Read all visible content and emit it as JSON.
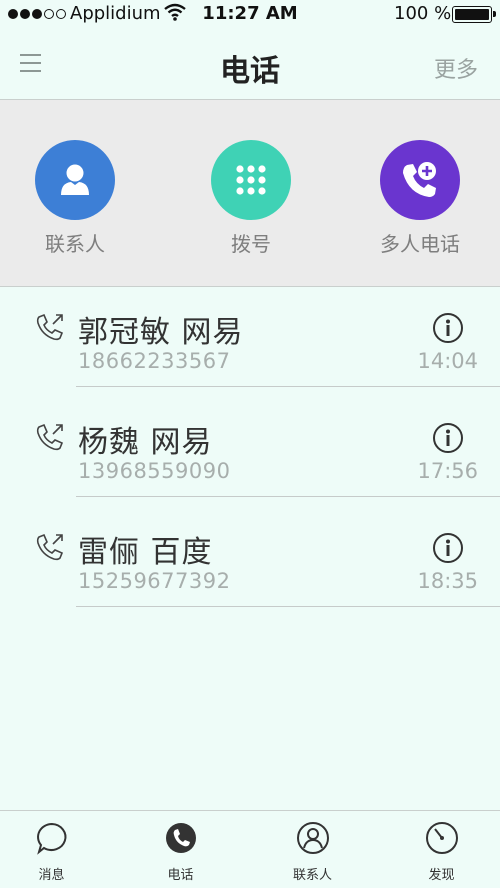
{
  "status_bar": {
    "carrier": "Applidium",
    "time": "11:27 AM",
    "battery": "100 %"
  },
  "nav": {
    "title": "电话",
    "more": "更多"
  },
  "quick_actions": [
    {
      "label": "联系人",
      "icon": "contact-person-icon",
      "color": "#3d7fd6"
    },
    {
      "label": "拨号",
      "icon": "dialpad-icon",
      "color": "#3fd2b5"
    },
    {
      "label": "多人电话",
      "icon": "add-call-icon",
      "color": "#6a35cf"
    }
  ],
  "calls": [
    {
      "name": "郭冠敏  网易",
      "number": "18662233567",
      "time": "14:04"
    },
    {
      "name": "杨魏  网易",
      "number": "13968559090",
      "time": "17:56"
    },
    {
      "name": "雷俪  百度",
      "number": "15259677392",
      "time": "18:35"
    }
  ],
  "tabs": [
    {
      "label": "消息",
      "icon": "message-bubble-icon"
    },
    {
      "label": "电话",
      "icon": "phone-tab-icon",
      "active": true
    },
    {
      "label": "联系人",
      "icon": "contacts-tab-icon"
    },
    {
      "label": "发现",
      "icon": "discover-compass-icon"
    }
  ],
  "colors": {
    "background": "#eefcf8",
    "panel": "#ebebeb",
    "muted_text": "#a7aeac"
  }
}
